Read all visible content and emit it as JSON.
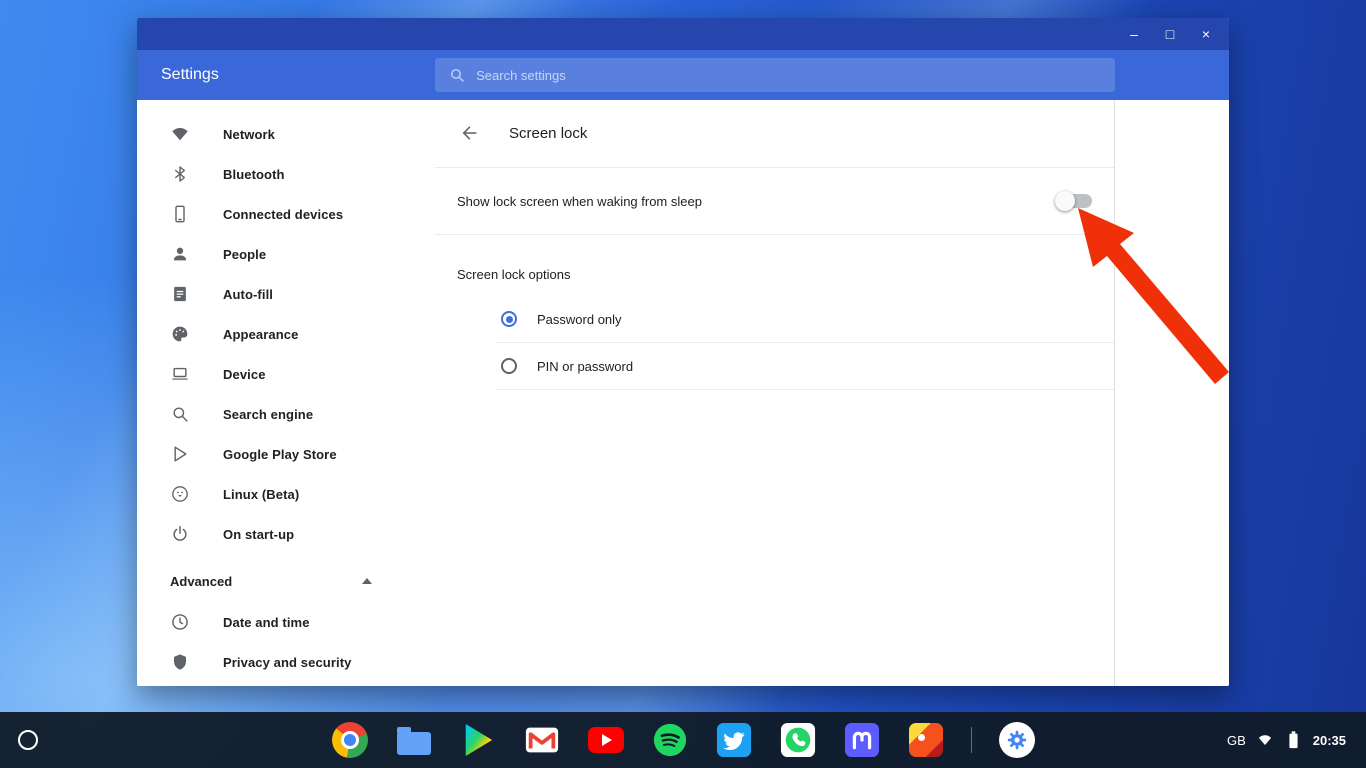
{
  "window": {
    "controls": {
      "minimize": "–",
      "maximize": "□",
      "close": "×"
    }
  },
  "header": {
    "app_title": "Settings",
    "search_placeholder": "Search settings"
  },
  "sidebar": {
    "items": [
      {
        "label": "Network",
        "icon": "wifi-icon"
      },
      {
        "label": "Bluetooth",
        "icon": "bluetooth-icon"
      },
      {
        "label": "Connected devices",
        "icon": "smartphone-icon"
      },
      {
        "label": "People",
        "icon": "person-icon"
      },
      {
        "label": "Auto-fill",
        "icon": "assignment-icon"
      },
      {
        "label": "Appearance",
        "icon": "palette-icon"
      },
      {
        "label": "Device",
        "icon": "laptop-icon"
      },
      {
        "label": "Search engine",
        "icon": "magnifier-icon"
      },
      {
        "label": "Google Play Store",
        "icon": "play-icon"
      },
      {
        "label": "Linux (Beta)",
        "icon": "penguin-icon"
      },
      {
        "label": "On start-up",
        "icon": "power-icon"
      }
    ],
    "advanced_label": "Advanced",
    "advanced_items": [
      {
        "label": "Date and time",
        "icon": "clock-icon"
      },
      {
        "label": "Privacy and security",
        "icon": "shield-icon"
      }
    ]
  },
  "page": {
    "title": "Screen lock",
    "toggle": {
      "label": "Show lock screen when waking from sleep",
      "state": "off"
    },
    "section_title": "Screen lock options",
    "options": [
      {
        "label": "Password only",
        "selected": true
      },
      {
        "label": "PIN or password",
        "selected": false
      }
    ]
  },
  "shelf": {
    "apps": [
      "chrome",
      "files",
      "google-play",
      "gmail",
      "youtube",
      "spotify",
      "twitter",
      "whatsapp",
      "mastodon",
      "game",
      "settings"
    ],
    "status": {
      "keyboard_layout": "GB",
      "time": "20:35"
    }
  },
  "colors": {
    "titlebar": "#2446ad",
    "header": "#3a68d8",
    "accent": "#3f6fdb",
    "annotation_arrow": "#f03008"
  }
}
